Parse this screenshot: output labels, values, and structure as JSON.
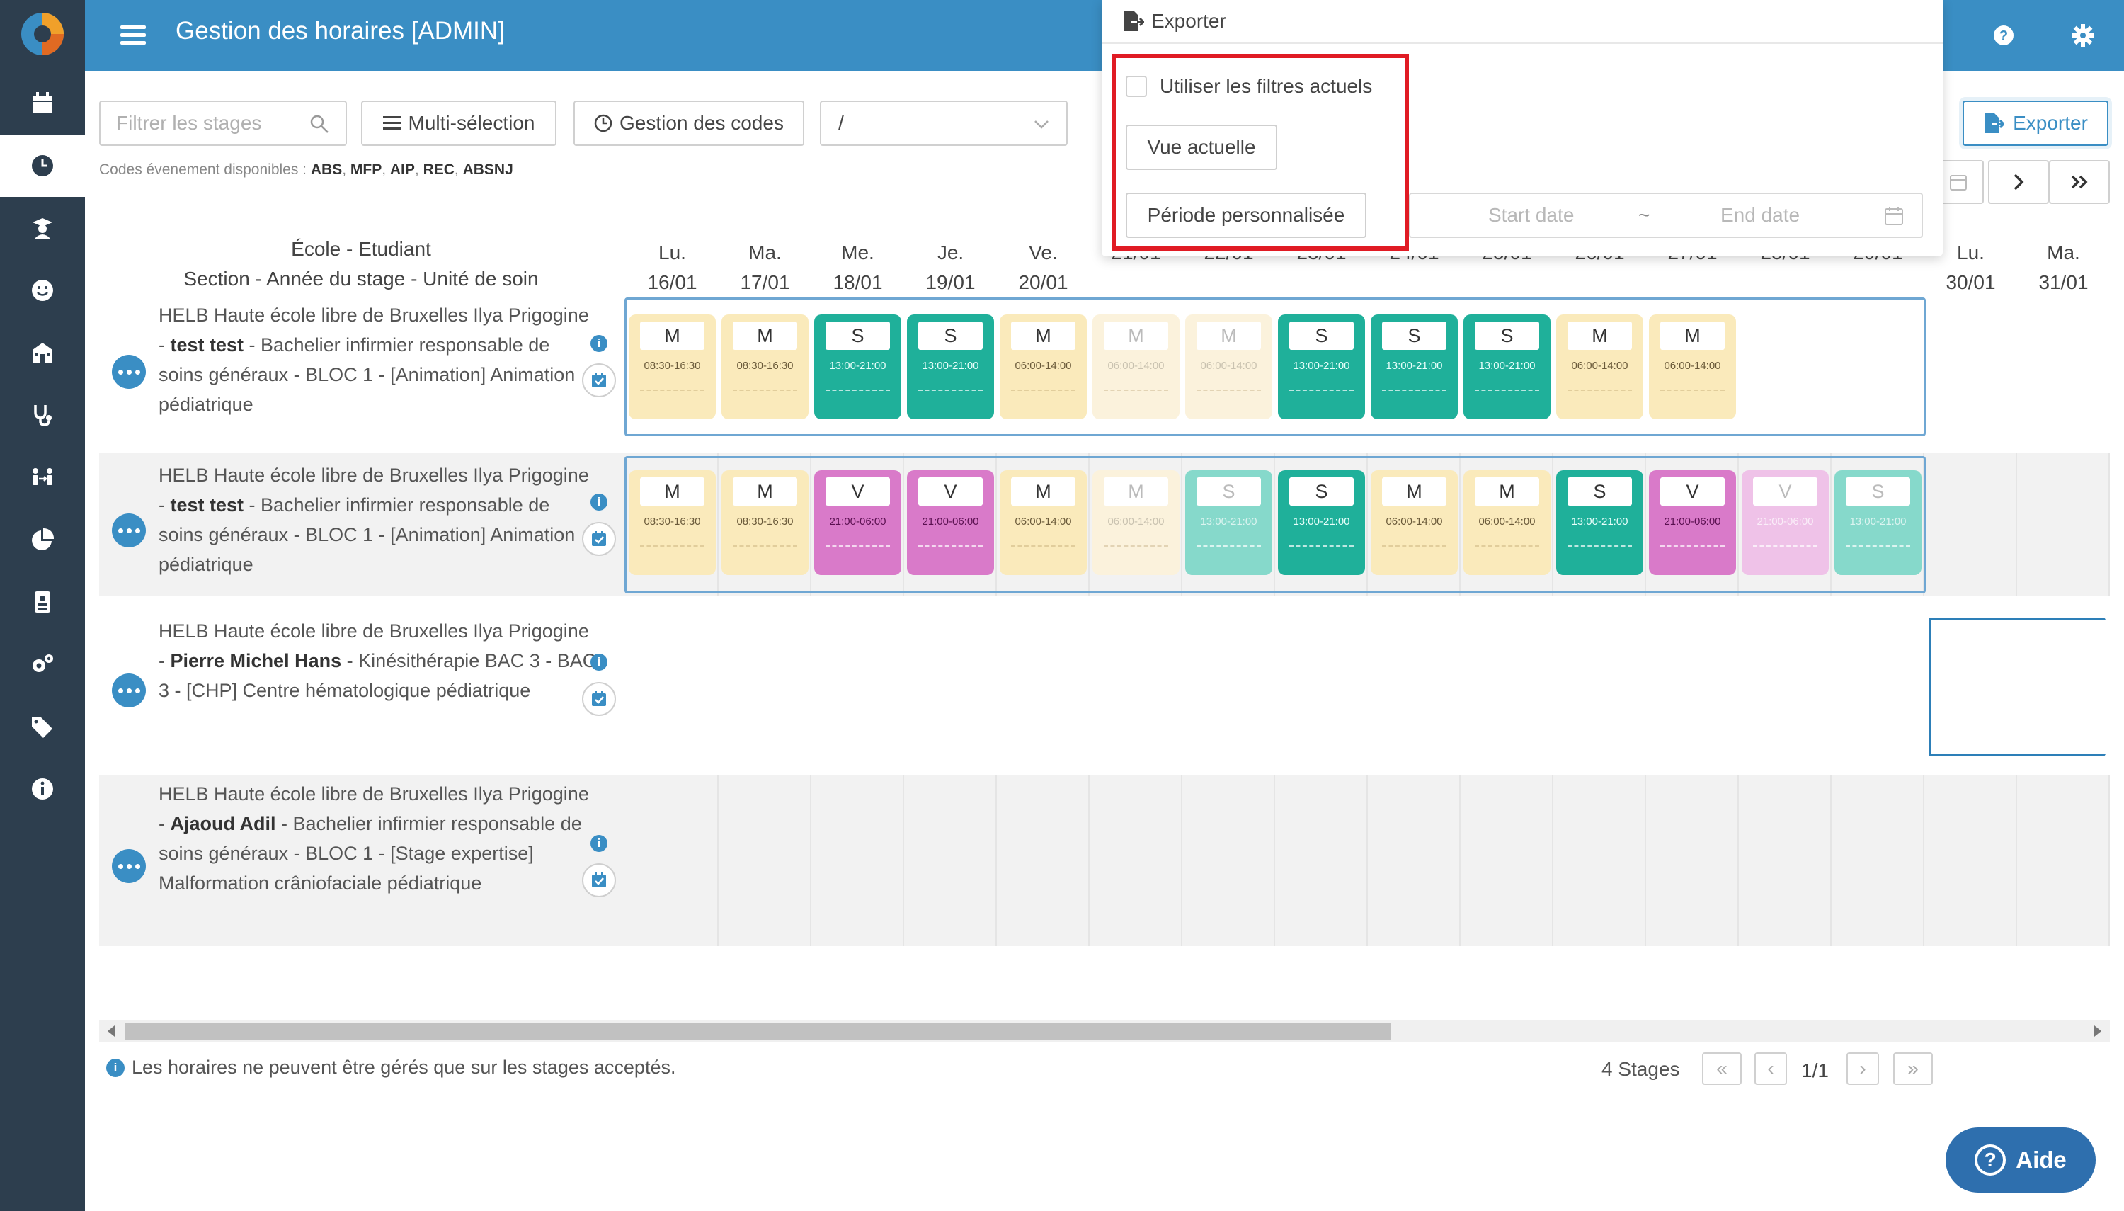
{
  "app": {
    "title": "Gestion des horaires [ADMIN]"
  },
  "toolbar": {
    "filter_placeholder": "Filtrer les stages",
    "multi_select": "Multi-sélection",
    "codes_management": "Gestion des codes",
    "select_value": "/",
    "export": "Exporter",
    "codes_label": "Codes évenement disponibles :",
    "codes": [
      "ABS",
      "MFP",
      "AIP",
      "REC",
      "ABSNJ"
    ]
  },
  "export_panel": {
    "title": "Exporter",
    "use_filters": "Utiliser les filtres actuels",
    "current_view": "Vue actuelle",
    "custom_period": "Période personnalisée",
    "start_placeholder": "Start date",
    "separator": "~",
    "end_placeholder": "End date"
  },
  "header": {
    "line1": "École - Etudiant",
    "line2": "Section - Année du stage - Unité de soin"
  },
  "days": [
    {
      "dow": "Lu.",
      "date": "16/01"
    },
    {
      "dow": "Ma.",
      "date": "17/01"
    },
    {
      "dow": "Me.",
      "date": "18/01"
    },
    {
      "dow": "Je.",
      "date": "19/01"
    },
    {
      "dow": "Ve.",
      "date": "20/01"
    },
    {
      "dow": "",
      "date": "21/01"
    },
    {
      "dow": "",
      "date": "22/01"
    },
    {
      "dow": "",
      "date": "23/01"
    },
    {
      "dow": "",
      "date": "24/01"
    },
    {
      "dow": "",
      "date": "25/01"
    },
    {
      "dow": "",
      "date": "26/01"
    },
    {
      "dow": "",
      "date": "27/01"
    },
    {
      "dow": "",
      "date": "28/01"
    },
    {
      "dow": "",
      "date": "29/01"
    },
    {
      "dow": "Lu.",
      "date": "30/01"
    },
    {
      "dow": "Ma.",
      "date": "31/01"
    }
  ],
  "rows": [
    {
      "school": "HELB Haute école libre de Bruxelles Ilya Prigogine",
      "student": "test test",
      "rest_lines": [
        "Bachelier infirmier",
        "responsable de soins généraux - BLOC 1 -",
        "[Animation] Animation pédiatrique"
      ],
      "shifts": [
        {
          "day": 0,
          "code": "M",
          "time": "08:30-16:30",
          "faded": false
        },
        {
          "day": 1,
          "code": "M",
          "time": "08:30-16:30",
          "faded": false
        },
        {
          "day": 2,
          "code": "S",
          "time": "13:00-21:00",
          "faded": false
        },
        {
          "day": 3,
          "code": "S",
          "time": "13:00-21:00",
          "faded": false
        },
        {
          "day": 4,
          "code": "M",
          "time": "06:00-14:00",
          "faded": false
        },
        {
          "day": 5,
          "code": "M",
          "time": "06:00-14:00",
          "faded": true
        },
        {
          "day": 6,
          "code": "M",
          "time": "06:00-14:00",
          "faded": true
        },
        {
          "day": 7,
          "code": "S",
          "time": "13:00-21:00",
          "faded": false
        },
        {
          "day": 8,
          "code": "S",
          "time": "13:00-21:00",
          "faded": false
        },
        {
          "day": 9,
          "code": "S",
          "time": "13:00-21:00",
          "faded": false
        },
        {
          "day": 10,
          "code": "M",
          "time": "06:00-14:00",
          "faded": false
        },
        {
          "day": 11,
          "code": "M",
          "time": "06:00-14:00",
          "faded": false
        }
      ]
    },
    {
      "school": "HELB Haute école libre de Bruxelles Ilya Prigogine",
      "student": "test test",
      "rest_lines": [
        "Bachelier infirmier",
        "responsable de soins généraux - BLOC 1 -",
        "[Animation] Animation pédiatrique"
      ],
      "shifts": [
        {
          "day": 0,
          "code": "M",
          "time": "08:30-16:30",
          "faded": false
        },
        {
          "day": 1,
          "code": "M",
          "time": "08:30-16:30",
          "faded": false
        },
        {
          "day": 2,
          "code": "V",
          "time": "21:00-06:00",
          "faded": false
        },
        {
          "day": 3,
          "code": "V",
          "time": "21:00-06:00",
          "faded": false
        },
        {
          "day": 4,
          "code": "M",
          "time": "06:00-14:00",
          "faded": false
        },
        {
          "day": 5,
          "code": "M",
          "time": "06:00-14:00",
          "faded": true
        },
        {
          "day": 6,
          "code": "S",
          "time": "13:00-21:00",
          "faded": true
        },
        {
          "day": 7,
          "code": "S",
          "time": "13:00-21:00",
          "faded": false
        },
        {
          "day": 8,
          "code": "M",
          "time": "06:00-14:00",
          "faded": false
        },
        {
          "day": 9,
          "code": "M",
          "time": "06:00-14:00",
          "faded": false
        },
        {
          "day": 10,
          "code": "S",
          "time": "13:00-21:00",
          "faded": false
        },
        {
          "day": 11,
          "code": "V",
          "time": "21:00-06:00",
          "faded": false
        },
        {
          "day": 12,
          "code": "V",
          "time": "21:00-06:00",
          "faded": true
        },
        {
          "day": 13,
          "code": "S",
          "time": "13:00-21:00",
          "faded": true
        }
      ]
    },
    {
      "school": "HELB Haute école libre de Bruxelles Ilya Prigogine",
      "student": "Pierre Michel Hans",
      "rest_lines": [
        "Kinésithérapie",
        "BAC 3 - BAC 3 - [CHP] Centre hématologique",
        "pédiatrique"
      ],
      "shifts": []
    },
    {
      "school": "HELB Haute école libre de Bruxelles Ilya Prigogine",
      "student": "Ajaoud Adil",
      "rest_lines": [
        "Bachelier infirmier",
        "responsable de soins généraux - BLOC 1 -",
        "[Stage expertise] Malformation crâniofaciale",
        "pédiatrique"
      ],
      "shifts": []
    }
  ],
  "footer": {
    "note": "Les horaires ne peuvent être gérés que sur les stages acceptés.",
    "count": "4 Stages",
    "page": "1/1",
    "help": "Aide"
  },
  "colors": {
    "topbar": "#3a8ec4",
    "rail": "#2d3e4e",
    "M": "#faeabb",
    "S": "#1fb09a",
    "V": "#d97ac9"
  }
}
